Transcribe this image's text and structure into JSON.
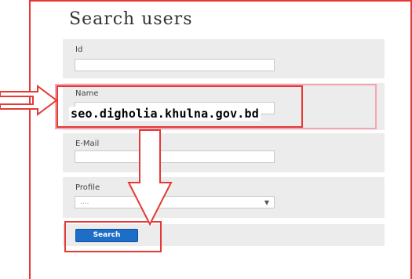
{
  "form": {
    "title": "Search users",
    "fields": {
      "id": {
        "label": "Id",
        "value": ""
      },
      "name": {
        "label": "Name",
        "value": ""
      },
      "email": {
        "label": "E-Mail",
        "value": ""
      },
      "profile": {
        "label": "Profile",
        "selected": "...."
      }
    },
    "search_button": "Search"
  },
  "annotation": {
    "overlay_text": "seo.digholia.khulna.gov.bd",
    "highlight_color": "#e53935",
    "pink_color": "#f4a6b3"
  },
  "theme": {
    "panel_bg": "#ececec",
    "button_bg": "#1e6ec8"
  }
}
